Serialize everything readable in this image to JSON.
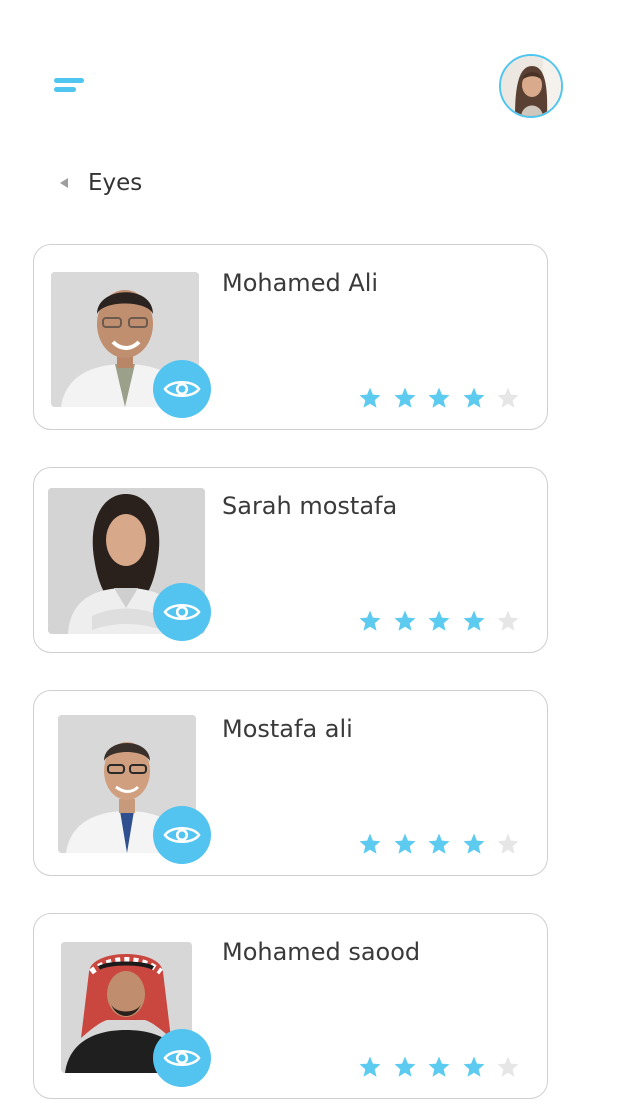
{
  "header": {
    "menu_icon": "hamburger-menu-icon",
    "avatar_icon": "user-avatar"
  },
  "page": {
    "title": "Eyes",
    "back_icon": "back-triangle-icon"
  },
  "colors": {
    "accent": "#4fc6ef",
    "star_filled": "#5ccbef",
    "star_empty": "#e6e6e6",
    "card_border": "#cfcfcf",
    "text": "#3a3a3a"
  },
  "doctors": [
    {
      "name": "Mohamed Ali",
      "rating": 4,
      "max_rating": 5,
      "view_icon": "eye-icon"
    },
    {
      "name": "Sarah mostafa",
      "rating": 4,
      "max_rating": 5,
      "view_icon": "eye-icon"
    },
    {
      "name": "Mostafa ali",
      "rating": 4,
      "max_rating": 5,
      "view_icon": "eye-icon"
    },
    {
      "name": "Mohamed saood",
      "rating": 4,
      "max_rating": 5,
      "view_icon": "eye-icon"
    }
  ]
}
